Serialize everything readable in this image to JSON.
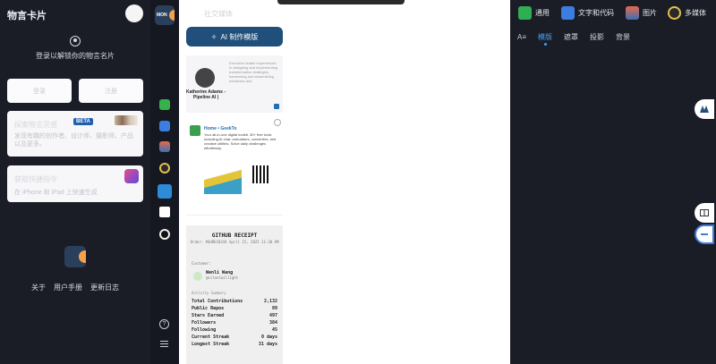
{
  "sidebar": {
    "brand": "物言卡片",
    "login_text": "登录以解锁你的物言名片",
    "btn_left": "登录",
    "btn_right": "注册",
    "card1_title": "探索物言灵感",
    "card1_badge": "BETA",
    "card1_desc": "发现有趣的创作者、设计师、摄影师、产品以及更多。",
    "card2_title": "获取快捷指令",
    "card2_desc": "在 iPhone 和 iPad 上快速生成",
    "footer": [
      "关于",
      "用户手册",
      "更新日志"
    ]
  },
  "rail": {
    "logo": "MON"
  },
  "templates": {
    "title": "社交媒体",
    "ai_button": "AI 制作模版",
    "t1": {
      "name": "Katherine Adams - Pipeline AI |",
      "desc": "Executive leader experienced in designing and implementing transformative strategies, harnessing and streamlining workflows and"
    },
    "t2": {
      "head": "Home • GeekTo",
      "desc": "Your all-in-one digital toolkit. 30+ free tools including AI chat, calculators, converters, and creative utilities. Solve daily challenges effortlessly."
    },
    "t3": {
      "title": "GITHUB RECEIPT",
      "sub": "Order: #GHREC0244 April 15, 2025 11:30 AM",
      "customer_label": "Customer:",
      "user_name": "Wenli Wang",
      "user_handle": "@silentwillight",
      "activity_label": "Activity Summary",
      "rows": [
        {
          "k": "Total Contributions",
          "v": "2,132"
        },
        {
          "k": "Public Repos",
          "v": "89"
        },
        {
          "k": "Stars Earned",
          "v": "497"
        },
        {
          "k": "Followers",
          "v": "384"
        },
        {
          "k": "Following",
          "v": "45"
        },
        {
          "k": "Current Streak",
          "v": "0 days"
        },
        {
          "k": "Longest Streak",
          "v": "31 days"
        }
      ]
    }
  },
  "options": {
    "categories": [
      "通用",
      "文字和代码",
      "图片",
      "多媒体"
    ],
    "tabs": [
      "模版",
      "遮罩",
      "投影",
      "背景"
    ],
    "active_tab": "模版"
  }
}
